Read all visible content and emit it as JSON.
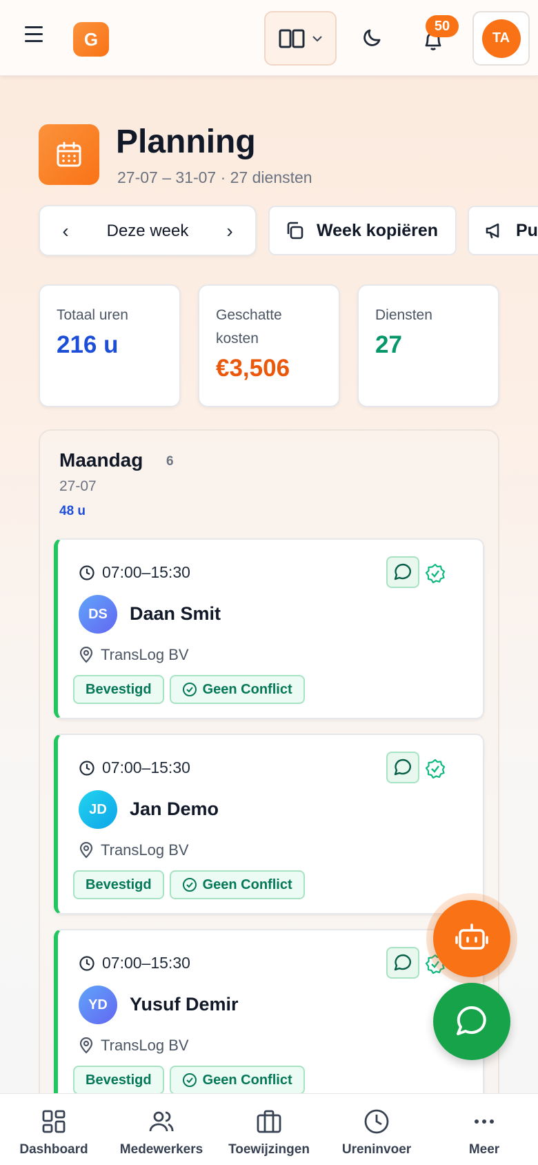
{
  "header": {
    "logo_letter": "G",
    "notification_count": "50",
    "user_initials": "TA"
  },
  "page": {
    "title": "Planning",
    "subtitle": "27-07 – 31-07 · 27 diensten"
  },
  "actions": {
    "week_label": "Deze week",
    "prev_icon": "chevron-left-icon",
    "next_icon": "chevron-right-icon",
    "copy_week_label": "Week kopiëren",
    "publish_label": "Pu"
  },
  "stats": [
    {
      "label": "Totaal uren",
      "value": "216 u",
      "color": "#1d4ed8"
    },
    {
      "label": "Geschatte kosten",
      "value": "€3,506",
      "color": "#ea580c"
    },
    {
      "label": "Diensten",
      "value": "27",
      "color": "#059669"
    }
  ],
  "day": {
    "name": "Maandag",
    "count": "6",
    "date": "27-07",
    "hours": "48 u",
    "shifts": [
      {
        "time": "07:00–15:30",
        "initials": "DS",
        "name": "Daan Smit",
        "location": "TransLog BV",
        "status": "Bevestigd",
        "conflict": "Geen Conflict",
        "avatar_color": "#6366f1"
      },
      {
        "time": "07:00–15:30",
        "initials": "JD",
        "name": "Jan Demo",
        "location": "TransLog BV",
        "status": "Bevestigd",
        "conflict": "Geen Conflict",
        "avatar_color": "#0ea5e9"
      },
      {
        "time": "07:00–15:30",
        "initials": "YD",
        "name": "Yusuf Demir",
        "location": "TransLog BV",
        "status": "Bevestigd",
        "conflict": "Geen Conflict",
        "avatar_color": "#6366f1"
      }
    ]
  },
  "bottom_nav": [
    {
      "label": "Dashboard",
      "icon": "dashboard-icon"
    },
    {
      "label": "Medewerkers",
      "icon": "users-icon"
    },
    {
      "label": "Toewijzingen",
      "icon": "briefcase-icon"
    },
    {
      "label": "Ureninvoer",
      "icon": "clock-icon"
    },
    {
      "label": "Meer",
      "icon": "more-icon"
    }
  ],
  "colors": {
    "accent": "#f97316",
    "success": "#16a34a",
    "primary_blue": "#1d4ed8"
  }
}
